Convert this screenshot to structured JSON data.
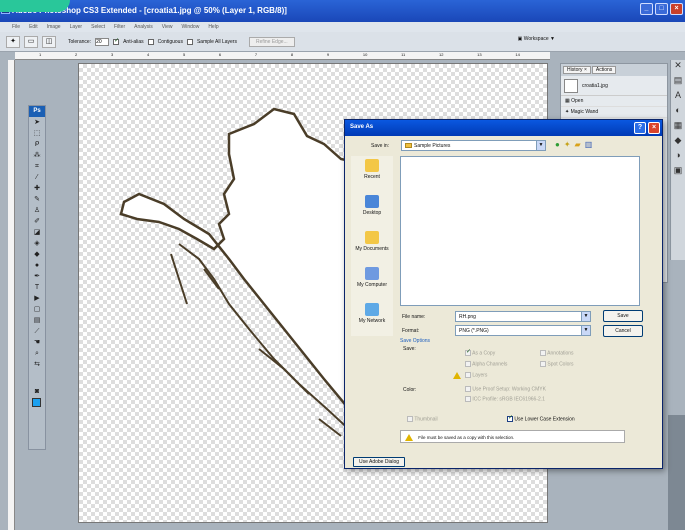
{
  "window": {
    "title": "Adobe Photoshop CS3 Extended - [croatia1.jpg @ 50% (Layer 1, RGB/8)]"
  },
  "menu": [
    "File",
    "Edit",
    "Image",
    "Layer",
    "Select",
    "Filter",
    "Analysis",
    "View",
    "Window",
    "Help"
  ],
  "options": {
    "tolerance_label": "Tolerance:",
    "tolerance_value": "20",
    "antialias": "Anti-alias",
    "contiguous": "Contiguous",
    "sample_all": "Sample All Layers",
    "refine": "Refine Edge...",
    "workspace": "Workspace ▼"
  },
  "ruler_ticks": [
    "1",
    "2",
    "3",
    "4",
    "5",
    "6",
    "7",
    "8",
    "9",
    "10",
    "11",
    "12",
    "13",
    "14"
  ],
  "history": {
    "tabs": [
      "History ×",
      "Actions"
    ],
    "snapshot": "croatia1.jpg",
    "steps": [
      "Open",
      "Magic Wand"
    ]
  },
  "dialog": {
    "title": "Save As",
    "save_in_label": "Save in:",
    "save_in_value": "Sample Pictures",
    "places": [
      "Recent",
      "Desktop",
      "My Documents",
      "My Computer",
      "My Network"
    ],
    "file_name_label": "File name:",
    "file_name_value": "RH.png",
    "format_label": "Format:",
    "format_value": "PNG (*.PNG)",
    "save_button": "Save",
    "cancel_button": "Cancel",
    "save_options_title": "Save Options",
    "save_label": "Save:",
    "as_copy": "As a Copy",
    "annotations": "Annotations",
    "alpha_channels": "Alpha Channels",
    "spot_colors": "Spot Colors",
    "layers": "Layers",
    "color_label": "Color:",
    "use_proof": "Use Proof Setup:  Working CMYK",
    "icc_profile": "ICC Profile:  sRGB IEC61966-2.1",
    "thumbnail": "Thumbnail",
    "lower_case": "Use Lower Case Extension",
    "message": "File must be saved as a copy with this selection.",
    "use_adobe_dialog": "Use Adobe Dialog"
  }
}
